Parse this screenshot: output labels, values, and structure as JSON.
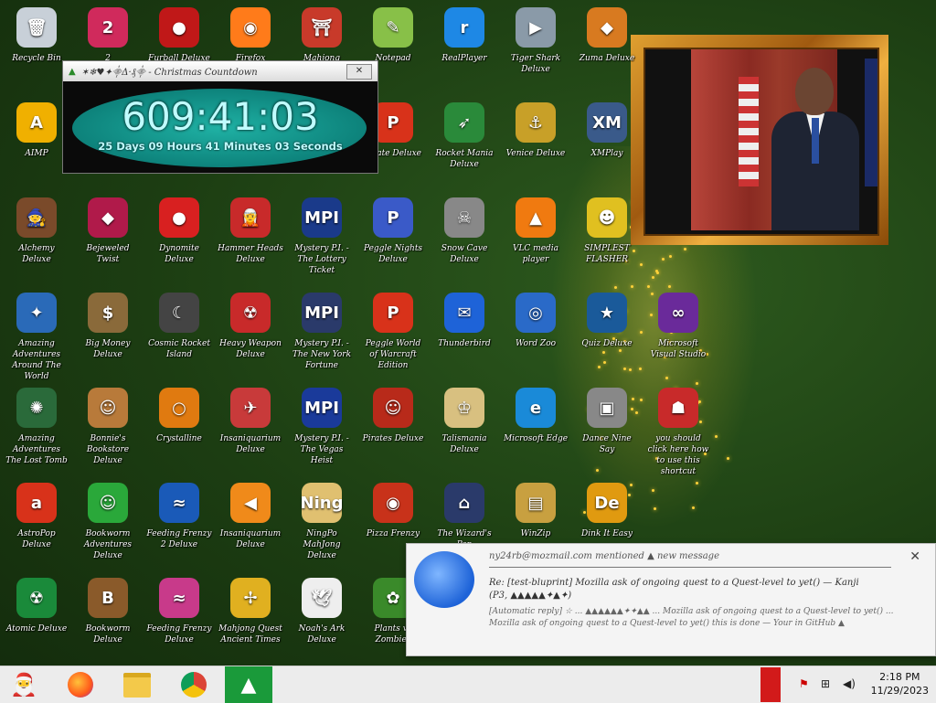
{
  "countdown": {
    "title_icon": "tree",
    "title": "✶❄♥✦⸎Δ·₰⸎ - Christmas Countdown",
    "big": "609:41:03",
    "small": "25 Days 09 Hours 41 Minutes 03 Seconds"
  },
  "desktop_icons": [
    {
      "label": "Recycle Bin",
      "color": "#c8d0d8",
      "glyph": "🗑"
    },
    {
      "label": "2",
      "color": "#d02a5c",
      "glyph": "2"
    },
    {
      "label": "Furball Deluxe",
      "color": "#c01818",
      "glyph": "●"
    },
    {
      "label": "Firefox",
      "color": "#ff7b1a",
      "glyph": "◉"
    },
    {
      "label": "Mahjong Deluxe",
      "color": "#c83a2a",
      "glyph": "⛩"
    },
    {
      "label": "Notepad",
      "color": "#88c048",
      "glyph": "✎"
    },
    {
      "label": "RealPlayer",
      "color": "#1e88e5",
      "glyph": "r"
    },
    {
      "label": "Tiger Shark Deluxe",
      "color": "#8a9aa8",
      "glyph": "▶"
    },
    {
      "label": "Zuma Deluxe",
      "color": "#d87a20",
      "glyph": "◆"
    },
    {
      "label": "AIMP",
      "color": "#f0b000",
      "glyph": "A"
    },
    {
      "label": "Pirate Deluxe",
      "color": "#d8321a",
      "glyph": "P"
    },
    {
      "label": "Rocket Mania Deluxe",
      "color": "#2a8a3a",
      "glyph": "➶"
    },
    {
      "label": "Venice Deluxe",
      "color": "#c8a028",
      "glyph": "⚓"
    },
    {
      "label": "XMPlay",
      "color": "#3a5a8a",
      "glyph": "XM"
    },
    {
      "label": "Alchemy Deluxe",
      "color": "#7a4a2a",
      "glyph": "🧙"
    },
    {
      "label": "Bejeweled Twist",
      "color": "#b01a4a",
      "glyph": "◆"
    },
    {
      "label": "Dynomite Deluxe",
      "color": "#d82020",
      "glyph": "●"
    },
    {
      "label": "Hammer Heads Deluxe",
      "color": "#c82a2a",
      "glyph": "🧝"
    },
    {
      "label": "Mystery P.I. - The Lottery Ticket",
      "color": "#1a3a8a",
      "glyph": "MPI"
    },
    {
      "label": "Peggle Nights Deluxe",
      "color": "#3a5ac8",
      "glyph": "P"
    },
    {
      "label": "Snow Cave Deluxe",
      "color": "#888",
      "glyph": "☠"
    },
    {
      "label": "VLC media player",
      "color": "#f07a10",
      "glyph": "▲"
    },
    {
      "label": "SIMPLEST FLASHER",
      "color": "#e0c020",
      "glyph": "☻"
    },
    {
      "label": "Amazing Adventures Around The World",
      "color": "#2a6ab8",
      "glyph": "✦"
    },
    {
      "label": "Big Money Deluxe",
      "color": "#8a6a3a",
      "glyph": "$"
    },
    {
      "label": "Cosmic Rocket Island",
      "color": "#444",
      "glyph": "☾"
    },
    {
      "label": "Heavy Weapon Deluxe",
      "color": "#c82a2a",
      "glyph": "☢"
    },
    {
      "label": "Mystery P.I. - The New York Fortune",
      "color": "#2a3a6a",
      "glyph": "MPI"
    },
    {
      "label": "Peggle World of Warcraft Edition",
      "color": "#d8321a",
      "glyph": "P"
    },
    {
      "label": "Thunderbird",
      "color": "#1e63d8",
      "glyph": "✉"
    },
    {
      "label": "Word Zoo",
      "color": "#2a6ac8",
      "glyph": "◎"
    },
    {
      "label": "Quiz Deluxe",
      "color": "#1a5a9a",
      "glyph": "★"
    },
    {
      "label": "Microsoft Visual Studio",
      "color": "#6a2a9a",
      "glyph": "∞"
    },
    {
      "label": "Amazing Adventures The Lost Tomb",
      "color": "#2a6a3a",
      "glyph": "✺"
    },
    {
      "label": "Bonnie's Bookstore Deluxe",
      "color": "#b87a3a",
      "glyph": "☺"
    },
    {
      "label": "Crystalline",
      "color": "#e07a10",
      "glyph": "○"
    },
    {
      "label": "Insaniquarium Deluxe",
      "color": "#c83a3a",
      "glyph": "✈"
    },
    {
      "label": "Mystery P.I. - The Vegas Heist",
      "color": "#1a3a9a",
      "glyph": "MPI"
    },
    {
      "label": "Pirates Deluxe",
      "color": "#b82a1a",
      "glyph": "☺"
    },
    {
      "label": "Talismania Deluxe",
      "color": "#d8c080",
      "glyph": "♔"
    },
    {
      "label": "Microsoft Edge",
      "color": "#1a8ad8",
      "glyph": "e"
    },
    {
      "label": "Dance Nine Say",
      "color": "#888",
      "glyph": "▣"
    },
    {
      "label": "you should click here how to use this shortcut",
      "color": "#c82a2a",
      "glyph": "☗"
    },
    {
      "label": "AstroPop Deluxe",
      "color": "#d8321a",
      "glyph": "a"
    },
    {
      "label": "Bookworm Adventures Deluxe",
      "color": "#2aa83a",
      "glyph": "☺"
    },
    {
      "label": "Feeding Frenzy 2 Deluxe",
      "color": "#1a5ab8",
      "glyph": "≈"
    },
    {
      "label": "Insaniquarium Deluxe",
      "color": "#f08a1a",
      "glyph": "◀"
    },
    {
      "label": "NingPo MahJong Deluxe",
      "color": "#e0c070",
      "glyph": "Ning"
    },
    {
      "label": "Pizza Frenzy",
      "color": "#c8321a",
      "glyph": "◉"
    },
    {
      "label": "The Wizard's Pen",
      "color": "#2a3a6a",
      "glyph": "⌂"
    },
    {
      "label": "WinZip",
      "color": "#c8a040",
      "glyph": "▤"
    },
    {
      "label": "Dink It Easy",
      "color": "#e09a10",
      "glyph": "De"
    },
    {
      "label": "Atomic Deluxe",
      "color": "#1a8a3a",
      "glyph": "☢"
    },
    {
      "label": "Bookworm Deluxe",
      "color": "#8a5a2a",
      "glyph": "B"
    },
    {
      "label": "Feeding Frenzy Deluxe",
      "color": "#c83a8a",
      "glyph": "≈"
    },
    {
      "label": "Mahjong Quest Ancient Times",
      "color": "#e0b020",
      "glyph": "✢"
    },
    {
      "label": "Noah's Ark Deluxe",
      "color": "#eee",
      "glyph": "🕊"
    },
    {
      "label": "Plants vs Zombies",
      "color": "#3a8a2a",
      "glyph": "✿"
    }
  ],
  "notification": {
    "from": "ny24rb@mozmail.com mentioned ▲ new message",
    "subject": "Re: [test-bluprint] Mozilla ask of ongoing quest to a Quest-level to yet() — Kanji",
    "subject2": "(P3, ▲▲▲▲▲✦▲✦)",
    "body": "[Automatic reply] ☆ ... ▲▲▲▲▲▲✦✦▲▲ ... Mozilla ask of ongoing quest to a Quest-level to yet() ... Mozilla ask of ongoing quest to a Quest-level to yet() this is done — Your in GitHub ▲",
    "close": "✕"
  },
  "taskbar": {
    "start_glyph": "🎅",
    "apps": [
      "firefox-icon",
      "file-explorer-icon",
      "chrome-icon",
      "christmas-tree-icon"
    ],
    "time": "2:18 PM",
    "date": "11/29/2023"
  }
}
